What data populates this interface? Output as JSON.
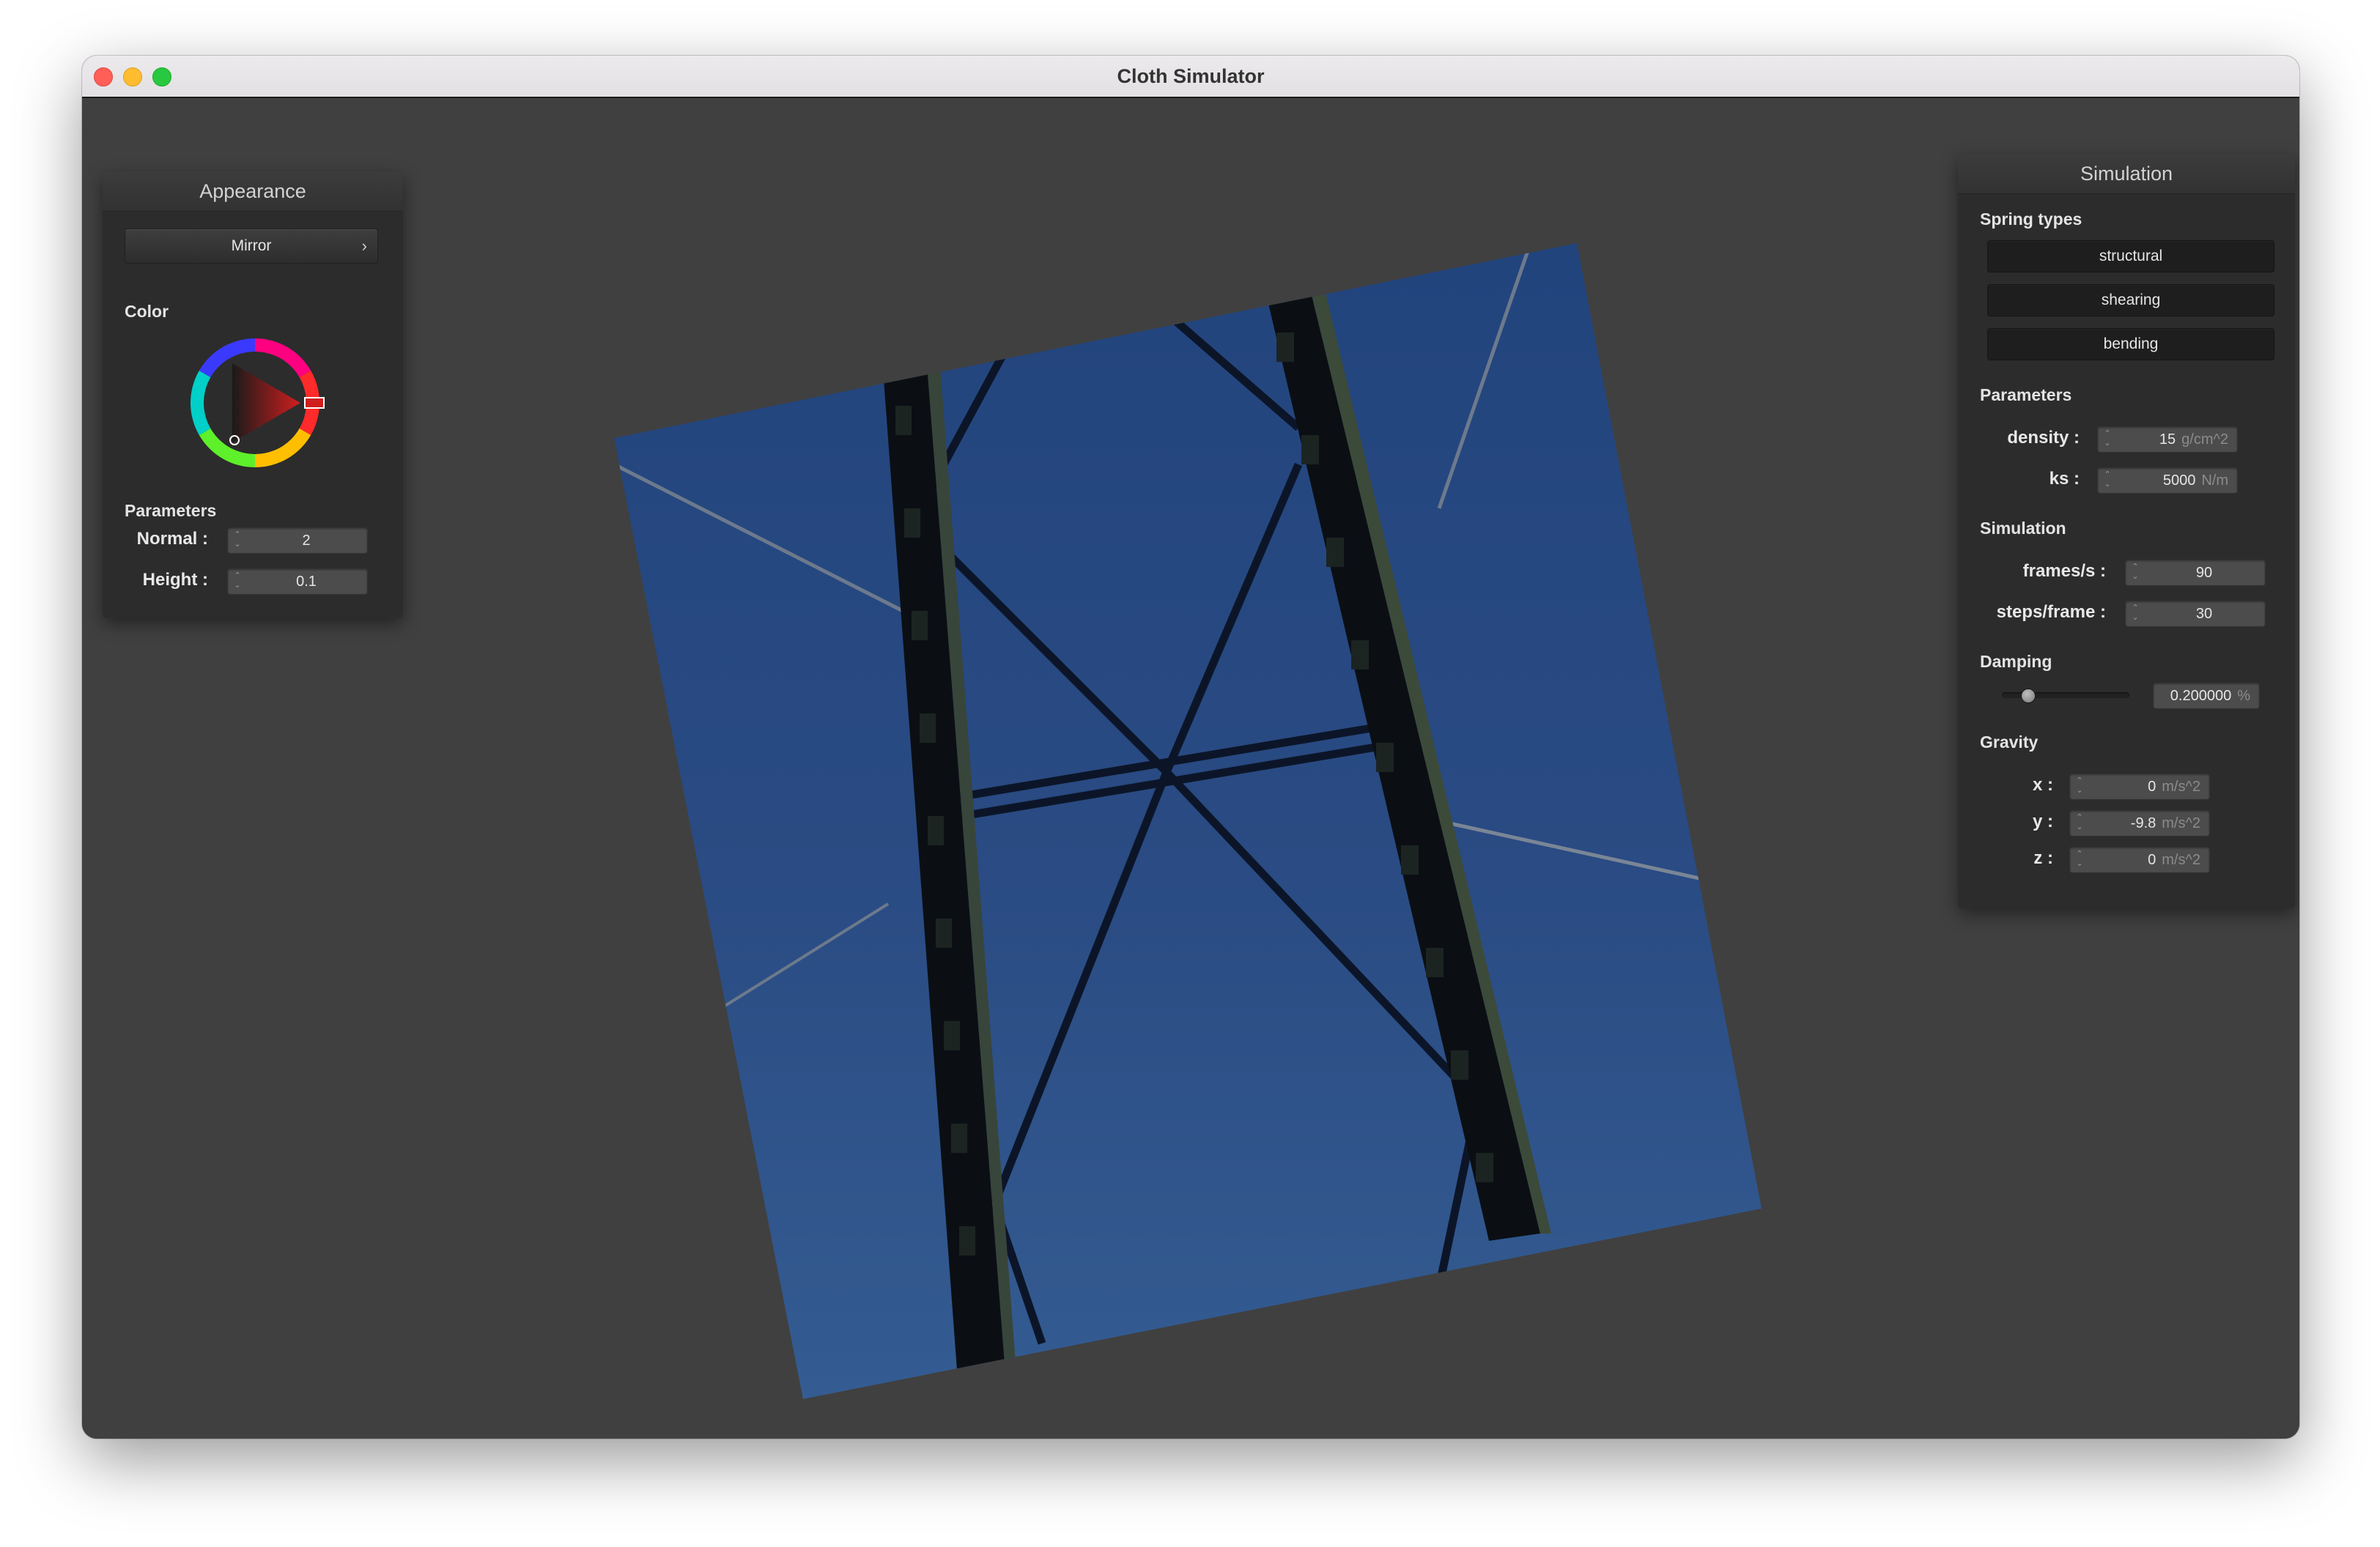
{
  "window": {
    "title": "Cloth Simulator"
  },
  "appearance": {
    "title": "Appearance",
    "shader_select": "Mirror",
    "color_label": "Color",
    "wheel_icon": "color-wheel-icon",
    "selected_color": "#c81e1e",
    "params_label": "Parameters",
    "normal": {
      "label": "Normal :",
      "value": "2"
    },
    "height": {
      "label": "Height :",
      "value": "0.1"
    }
  },
  "simulation": {
    "title": "Simulation",
    "spring_types_label": "Spring types",
    "spring_types": [
      "structural",
      "shearing",
      "bending"
    ],
    "parameters_label": "Parameters",
    "density": {
      "label": "density :",
      "value": "15",
      "unit": "g/cm^2"
    },
    "ks": {
      "label": "ks :",
      "value": "5000",
      "unit": "N/m"
    },
    "simulation_label": "Simulation",
    "fps": {
      "label": "frames/s :",
      "value": "90"
    },
    "steps": {
      "label": "steps/frame :",
      "value": "30"
    },
    "damping_label": "Damping",
    "damping": {
      "value": "0.200000",
      "unit": "%",
      "slider_fraction": 0.2
    },
    "gravity_label": "Gravity",
    "gravity": [
      {
        "label": "x :",
        "value": "0",
        "unit": "m/s^2"
      },
      {
        "label": "y :",
        "value": "-9.8",
        "unit": "m/s^2"
      },
      {
        "label": "z :",
        "value": "0",
        "unit": "m/s^2"
      }
    ]
  },
  "colors": {
    "viewport_bg": "#404040",
    "panel_bg": "#2c2c2c",
    "cloth_blue": "#2b4c82"
  }
}
